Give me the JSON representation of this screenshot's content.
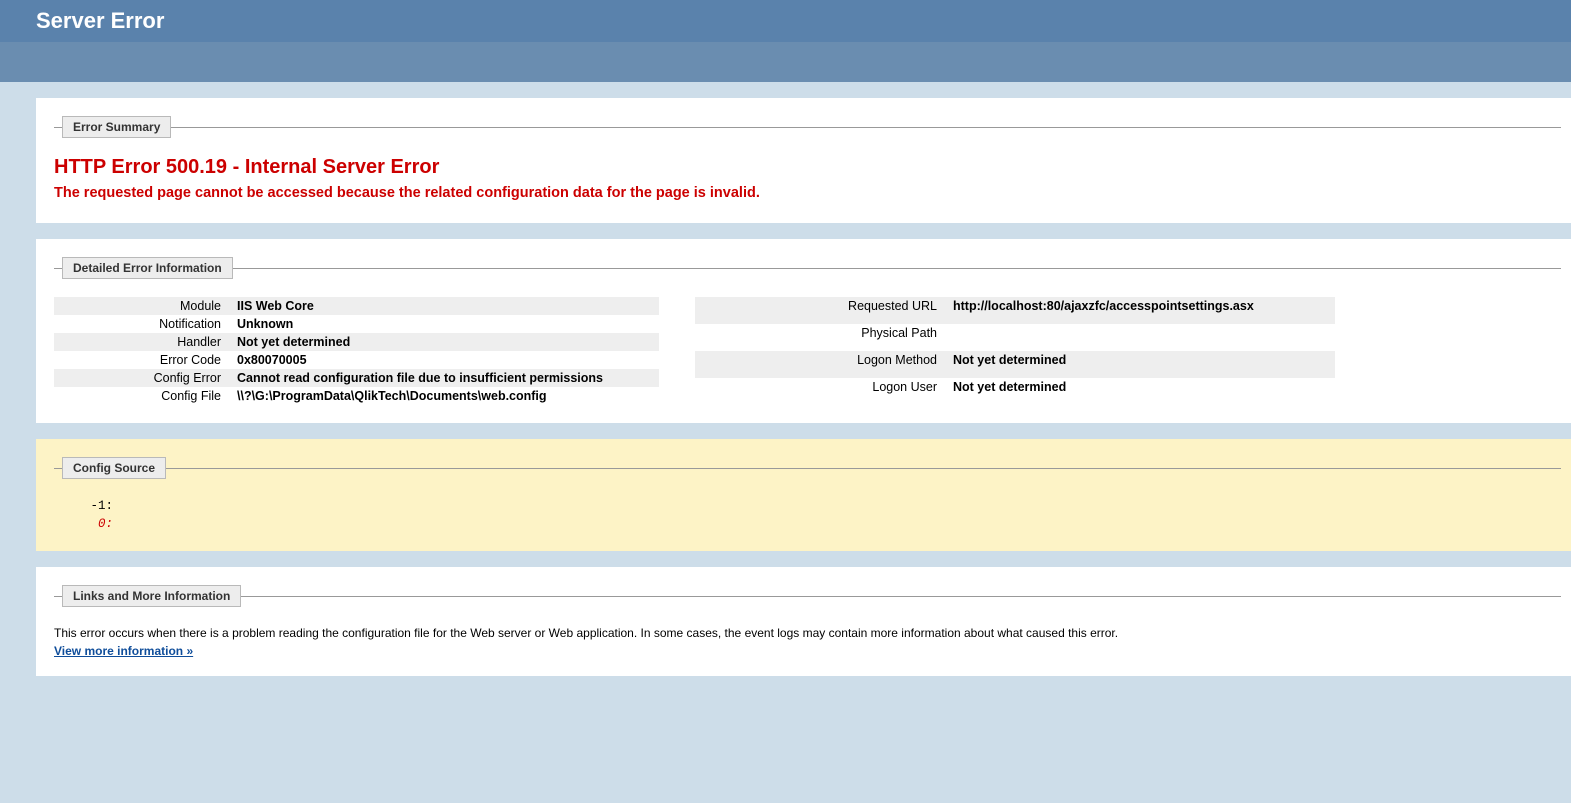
{
  "header": {
    "title": "Server Error"
  },
  "error_summary": {
    "legend": "Error Summary",
    "title": "HTTP Error 500.19 - Internal Server Error",
    "description": "The requested page cannot be accessed because the related configuration data for the page is invalid."
  },
  "detailed": {
    "legend": "Detailed Error Information",
    "left": [
      {
        "label": "Module",
        "value": "IIS Web Core"
      },
      {
        "label": "Notification",
        "value": "Unknown"
      },
      {
        "label": "Handler",
        "value": "Not yet determined"
      },
      {
        "label": "Error Code",
        "value": "0x80070005"
      },
      {
        "label": "Config Error",
        "value": "Cannot read configuration file due to insufficient permissions"
      },
      {
        "label": "Config File",
        "value": "\\\\?\\G:\\ProgramData\\QlikTech\\Documents\\web.config"
      }
    ],
    "right": [
      {
        "label": "Requested URL",
        "value": "http://localhost:80/ajaxzfc/accesspointsettings.asx"
      },
      {
        "label": "Physical Path",
        "value": ""
      },
      {
        "label": "Logon Method",
        "value": "Not yet determined"
      },
      {
        "label": "Logon User",
        "value": "Not yet determined"
      }
    ]
  },
  "config_source": {
    "legend": "Config Source",
    "line1": "   -1: ",
    "line2": "    0: "
  },
  "links": {
    "legend": "Links and More Information",
    "text": "This error occurs when there is a problem reading the configuration file for the Web server or Web application. In some cases, the event logs may contain more information about what caused this error.",
    "link_label": "View more information »"
  }
}
